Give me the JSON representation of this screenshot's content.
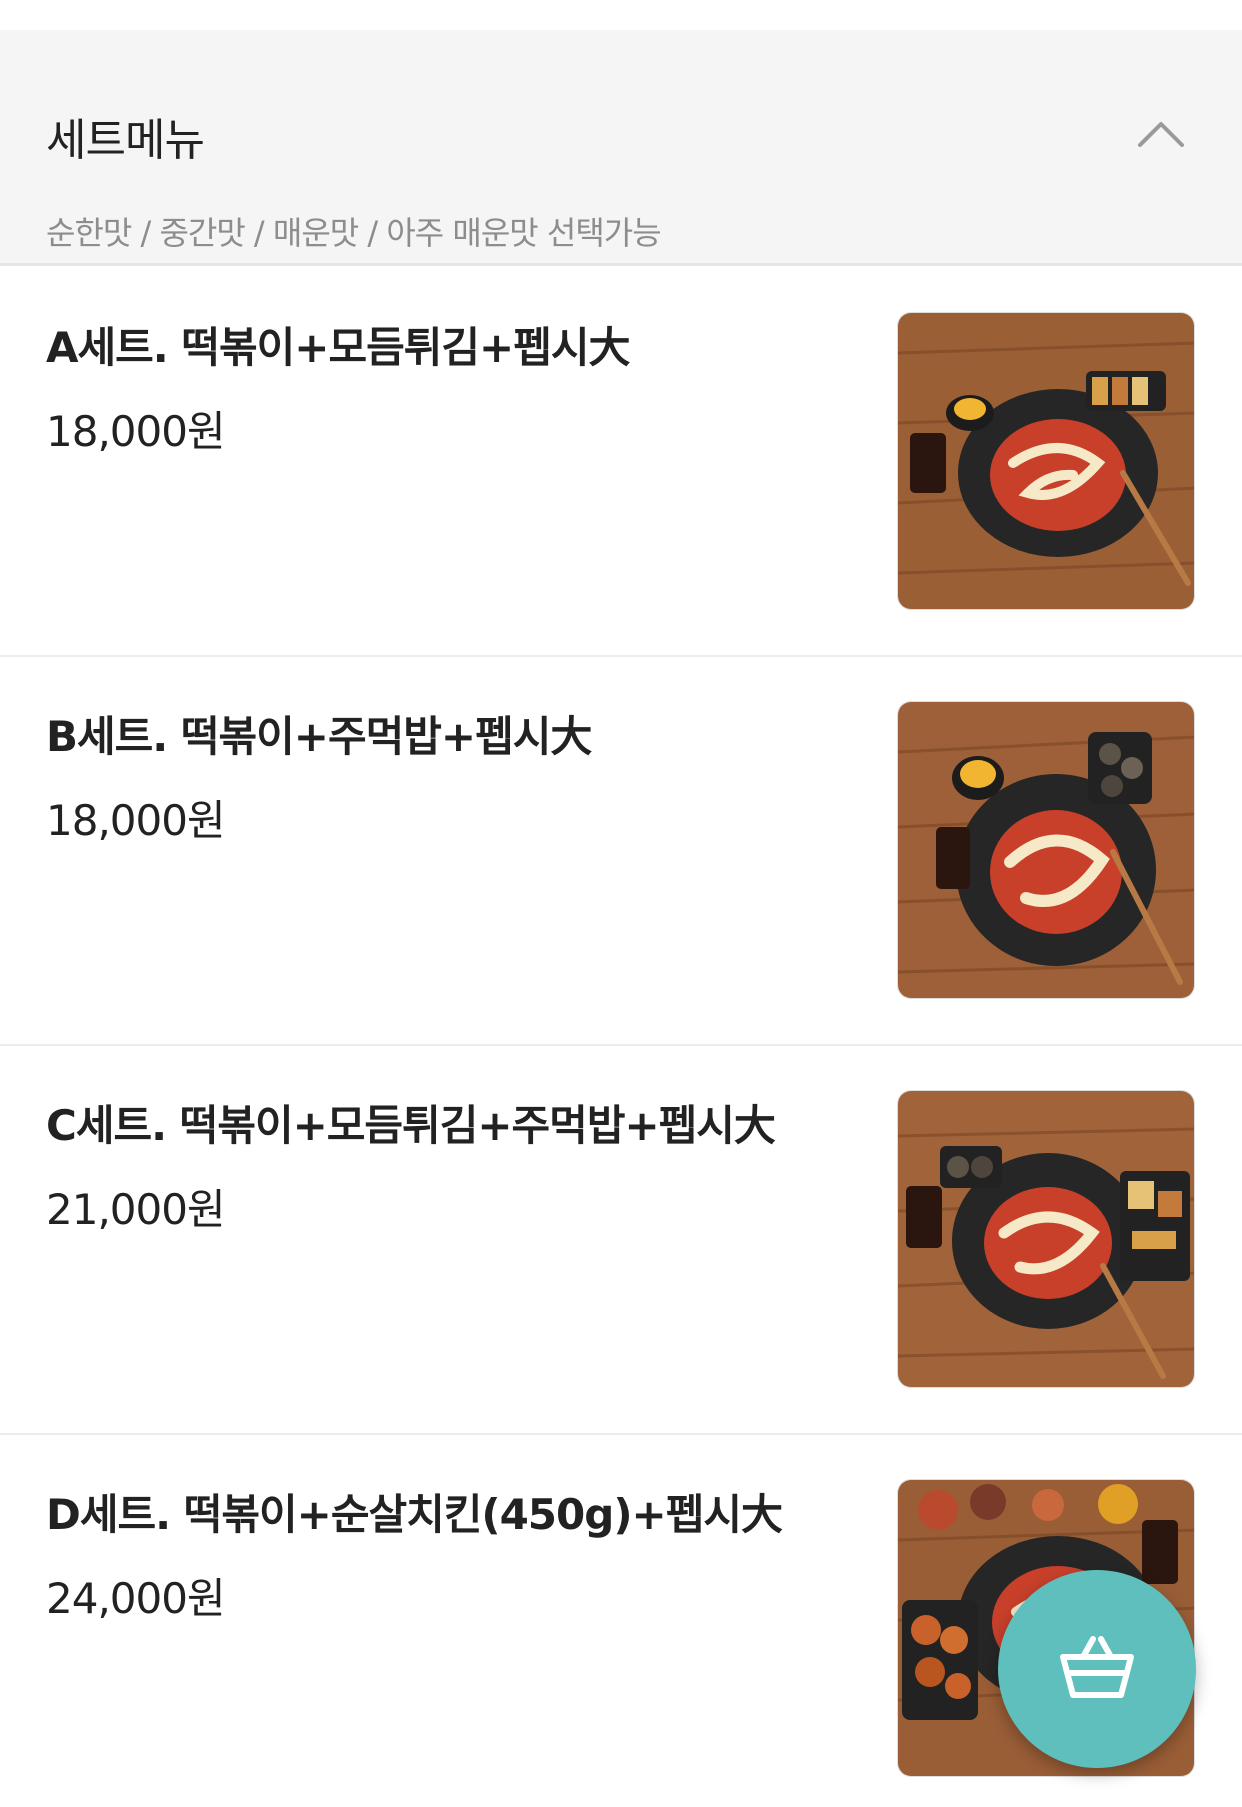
{
  "section": {
    "title": "세트메뉴",
    "description": "순한맛 / 중간맛 / 매운맛 / 아주 매운맛 선택가능",
    "collapse_icon": "chevron-up-icon"
  },
  "menu_items": [
    {
      "name": "A세트. 떡볶이+모듬튀김+펩시大",
      "price": "18,000원",
      "image": "tteokbokki-set-a-photo"
    },
    {
      "name": "B세트. 떡볶이+주먹밥+펩시大",
      "price": "18,000원",
      "image": "tteokbokki-set-b-photo"
    },
    {
      "name": "C세트. 떡볶이+모듬튀김+주먹밥+펩시大",
      "price": "21,000원",
      "image": "tteokbokki-set-c-photo"
    },
    {
      "name": "D세트. 떡볶이+순살치킨(450g)+펩시大",
      "price": "24,000원",
      "image": "tteokbokki-set-d-photo"
    }
  ],
  "cart_button": {
    "icon": "shopping-basket-icon",
    "color": "#5fbfbd"
  },
  "colors": {
    "header_bg": "#f5f5f5",
    "desc_text": "#8d8d8d",
    "accent": "#5fbfbd"
  }
}
